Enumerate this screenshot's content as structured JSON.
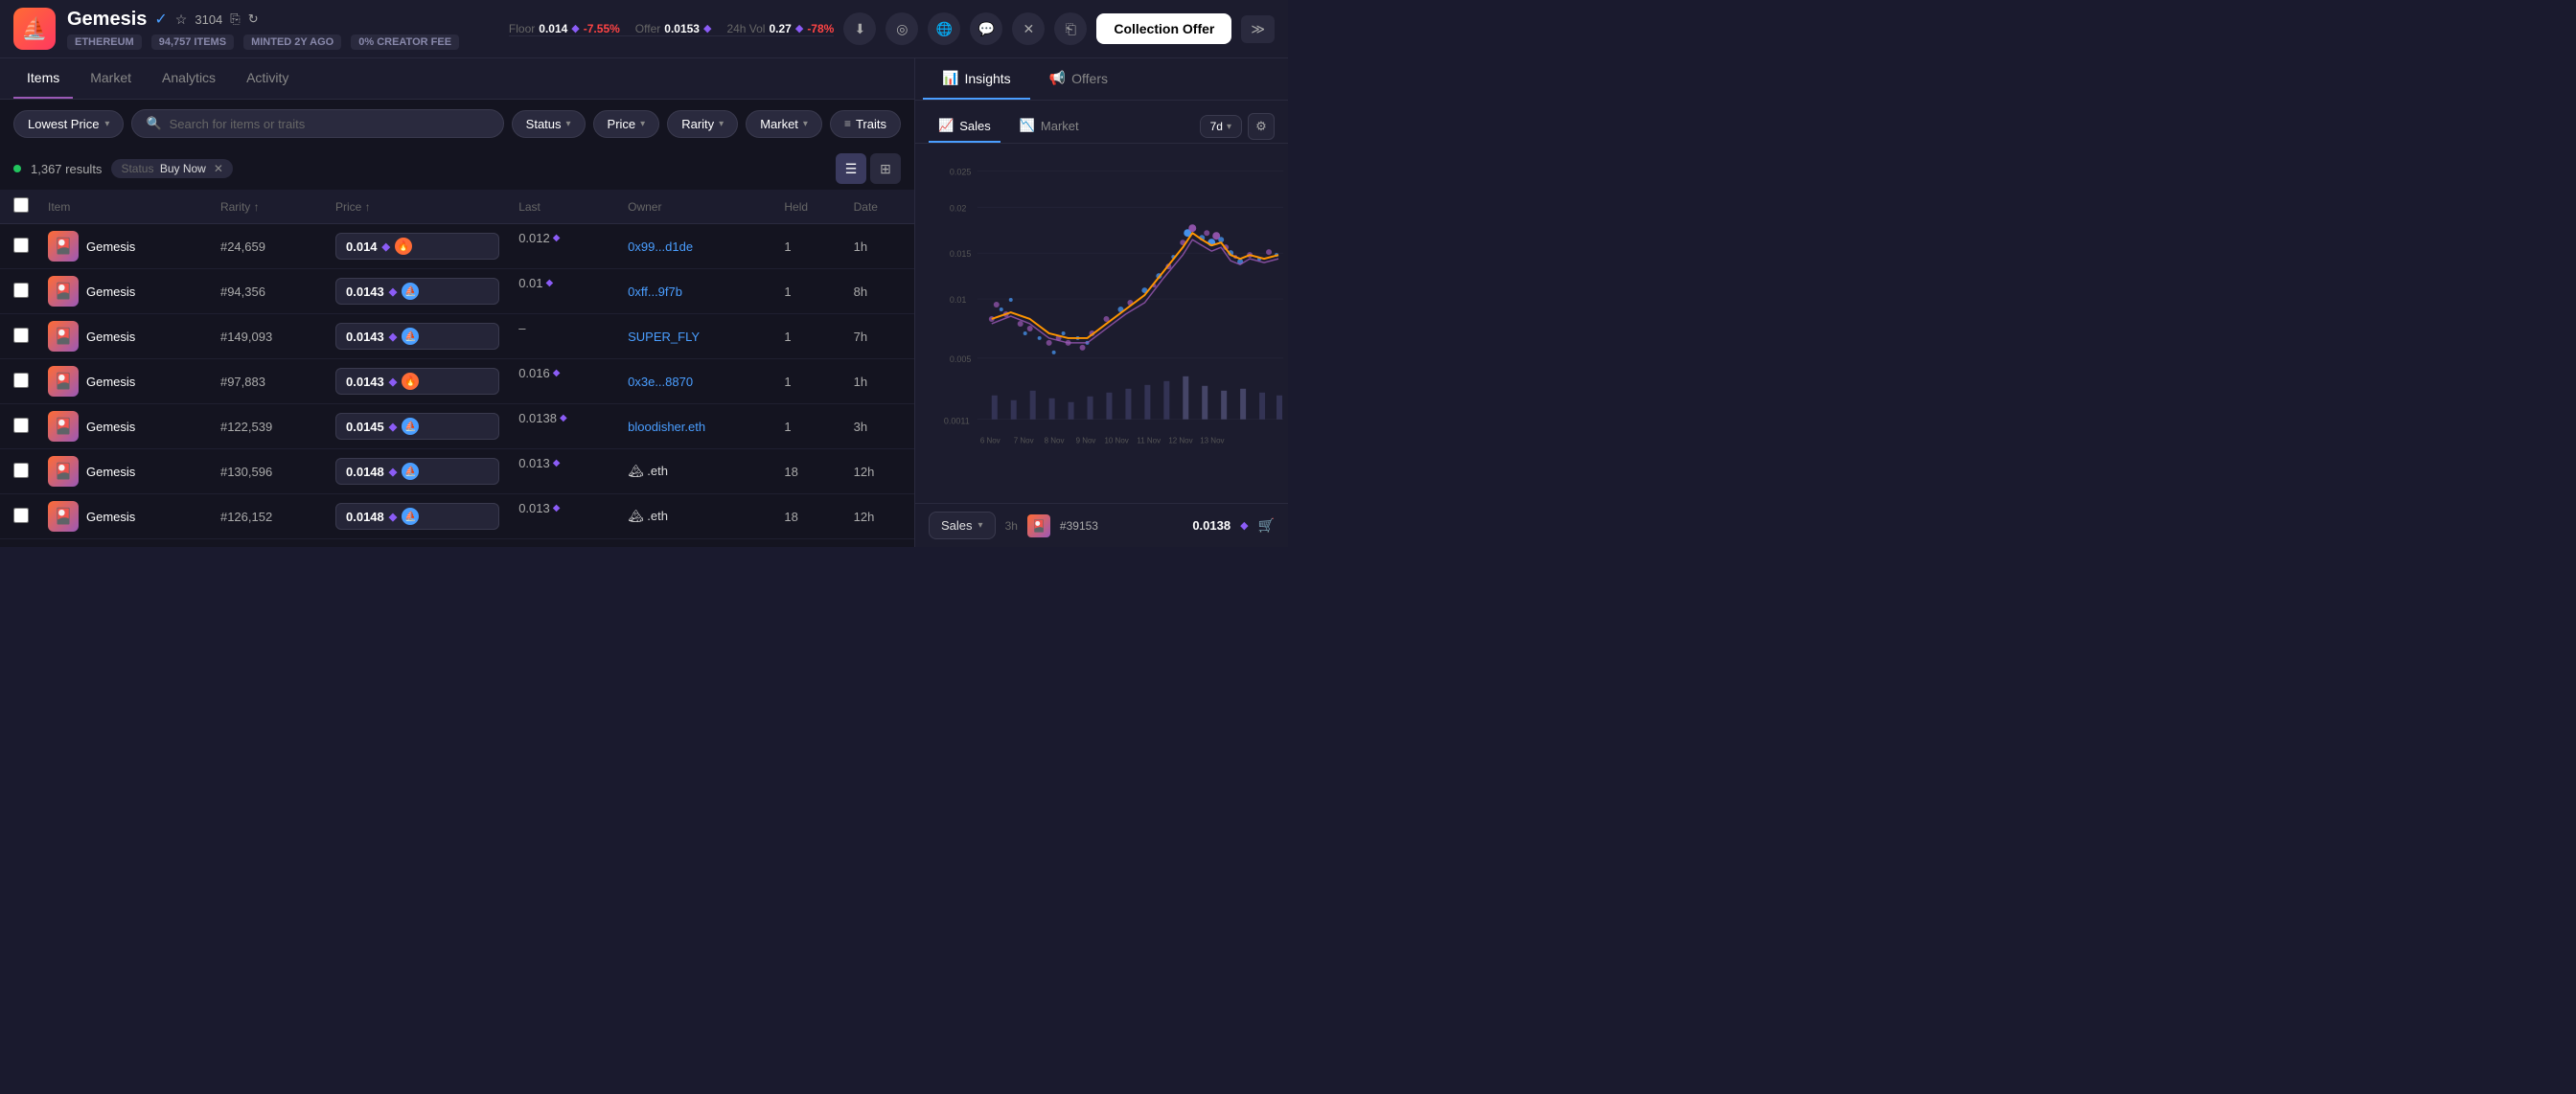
{
  "app": {
    "logo": "⛵",
    "collection_name": "Gemesis",
    "verified": true,
    "star_count": "3104",
    "meta": {
      "chain": "ETHEREUM",
      "items": "94,757 ITEMS",
      "minted": "MINTED 2Y AGO",
      "creator_fee": "0% CREATOR FEE"
    },
    "stats": {
      "floor_label": "Floor",
      "floor_value": "0.014",
      "floor_change": "-7.55%",
      "offer_label": "Offer",
      "offer_value": "0.0153",
      "vol_label": "24h Vol",
      "vol_value": "0.27",
      "vol_change": "-78%"
    }
  },
  "tabs": {
    "items": {
      "label": "Items",
      "active": true
    },
    "market": {
      "label": "Market"
    },
    "analytics": {
      "label": "Analytics"
    },
    "activity": {
      "label": "Activity"
    }
  },
  "filters": {
    "sort_label": "Lowest Price",
    "search_placeholder": "Search for items or traits",
    "status_label": "Status",
    "price_label": "Price",
    "rarity_label": "Rarity",
    "market_label": "Market",
    "traits_label": "Traits"
  },
  "results": {
    "count": "1,367 results",
    "active_filter_label": "Status",
    "active_filter_value": "Buy Now"
  },
  "table": {
    "headers": {
      "item": "Item",
      "rarity": "Rarity ↑",
      "price": "Price ↑",
      "last": "Last",
      "owner": "Owner",
      "held": "Held",
      "date": "Date"
    },
    "rows": [
      {
        "rarity": "#24,659",
        "name": "Gemesis",
        "price": "0.014",
        "marketplace": "blur",
        "last_price": "0.012",
        "owner": "0x99...d1de",
        "held": "1",
        "date": "1h"
      },
      {
        "rarity": "#94,356",
        "name": "Gemesis",
        "price": "0.0143",
        "marketplace": "opensea",
        "last_price": "0.01",
        "owner": "0xff...9f7b",
        "held": "1",
        "date": "8h"
      },
      {
        "rarity": "#149,093",
        "name": "Gemesis",
        "price": "0.0143",
        "marketplace": "opensea",
        "last_price": "–",
        "owner": "SUPER_FLY",
        "held": "1",
        "date": "7h"
      },
      {
        "rarity": "#97,883",
        "name": "Gemesis",
        "price": "0.0143",
        "marketplace": "blur",
        "last_price": "0.016",
        "owner": "0x3e...8870",
        "held": "1",
        "date": "1h"
      },
      {
        "rarity": "#122,539",
        "name": "Gemesis",
        "price": "0.0145",
        "marketplace": "opensea",
        "last_price": "0.0138",
        "owner": "bloodisher.eth",
        "held": "1",
        "date": "3h"
      },
      {
        "rarity": "#130,596",
        "name": "Gemesis",
        "price": "0.0148",
        "marketplace": "opensea",
        "last_price": "0.013",
        "owner": "🏔 .eth",
        "held": "18",
        "date": "12h"
      },
      {
        "rarity": "#126,152",
        "name": "Gemesis",
        "price": "0.0148",
        "marketplace": "opensea",
        "last_price": "0.013",
        "owner": "🏔 .eth",
        "held": "18",
        "date": "12h"
      }
    ]
  },
  "right_panel": {
    "insights_tab": "Insights",
    "offers_tab": "Offers",
    "sales_tab": "Sales",
    "market_tab": "Market",
    "period": "7d",
    "chart": {
      "y_labels": [
        "0.025",
        "0.02",
        "0.015",
        "0.01",
        "0.005",
        "0.0011"
      ],
      "x_labels": [
        "6 Nov",
        "7 Nov",
        "8 Nov",
        "9 Nov",
        "10 Nov",
        "11 Nov",
        "12 Nov",
        "13 Nov"
      ]
    },
    "sales_footer": {
      "label": "Sales",
      "item_id": "#39153",
      "item_price": "0.0138",
      "time": "3h"
    }
  },
  "collection_offer_btn": "Collection Offer"
}
